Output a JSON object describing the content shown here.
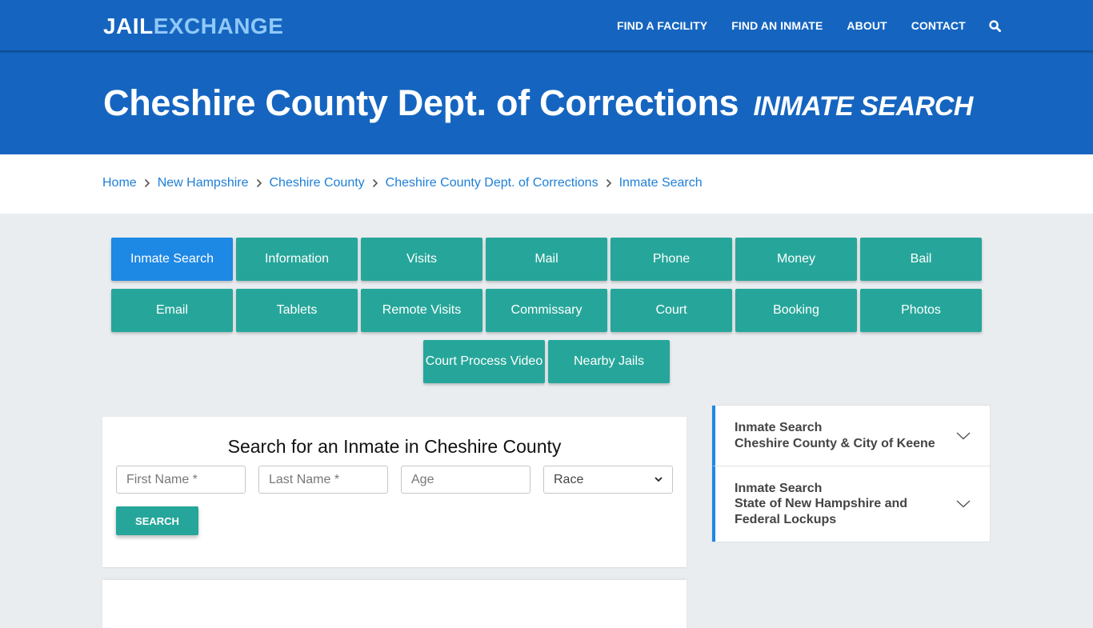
{
  "header": {
    "logo_part1": "JAIL",
    "logo_part2": "EXCHANGE",
    "nav": [
      "FIND A FACILITY",
      "FIND AN INMATE",
      "ABOUT",
      "CONTACT"
    ],
    "search_icon": "search-icon"
  },
  "hero": {
    "title": "Cheshire County Dept. of Corrections",
    "subtitle": "INMATE SEARCH"
  },
  "breadcrumb": [
    "Home",
    "New Hampshire",
    "Cheshire County",
    "Cheshire County Dept. of Corrections",
    "Inmate Search"
  ],
  "tabs": {
    "row1": [
      "Inmate Search",
      "Information",
      "Visits",
      "Mail",
      "Phone",
      "Money",
      "Bail"
    ],
    "row2": [
      "Email",
      "Tablets",
      "Remote Visits",
      "Commissary",
      "Court",
      "Booking",
      "Photos"
    ],
    "row3": [
      "Court Process Video",
      "Nearby Jails"
    ],
    "active": "Inmate Search"
  },
  "search_form": {
    "title": "Search for an Inmate in Cheshire County",
    "first_name_placeholder": "First Name *",
    "last_name_placeholder": "Last Name *",
    "age_placeholder": "Age",
    "race_selected": "Race",
    "submit_label": "SEARCH"
  },
  "sidebar": {
    "items": [
      {
        "line1": "Inmate Search",
        "line2": "Cheshire County & City of Keene"
      },
      {
        "line1": "Inmate Search",
        "line2": "State of New Hampshire and Federal Lockups"
      }
    ]
  },
  "colors": {
    "brand_blue": "#1565c0",
    "logo_accent": "#90c8f8",
    "teal": "#26a69a",
    "active_tab": "#1e88e5",
    "link": "#1e7fd8"
  }
}
